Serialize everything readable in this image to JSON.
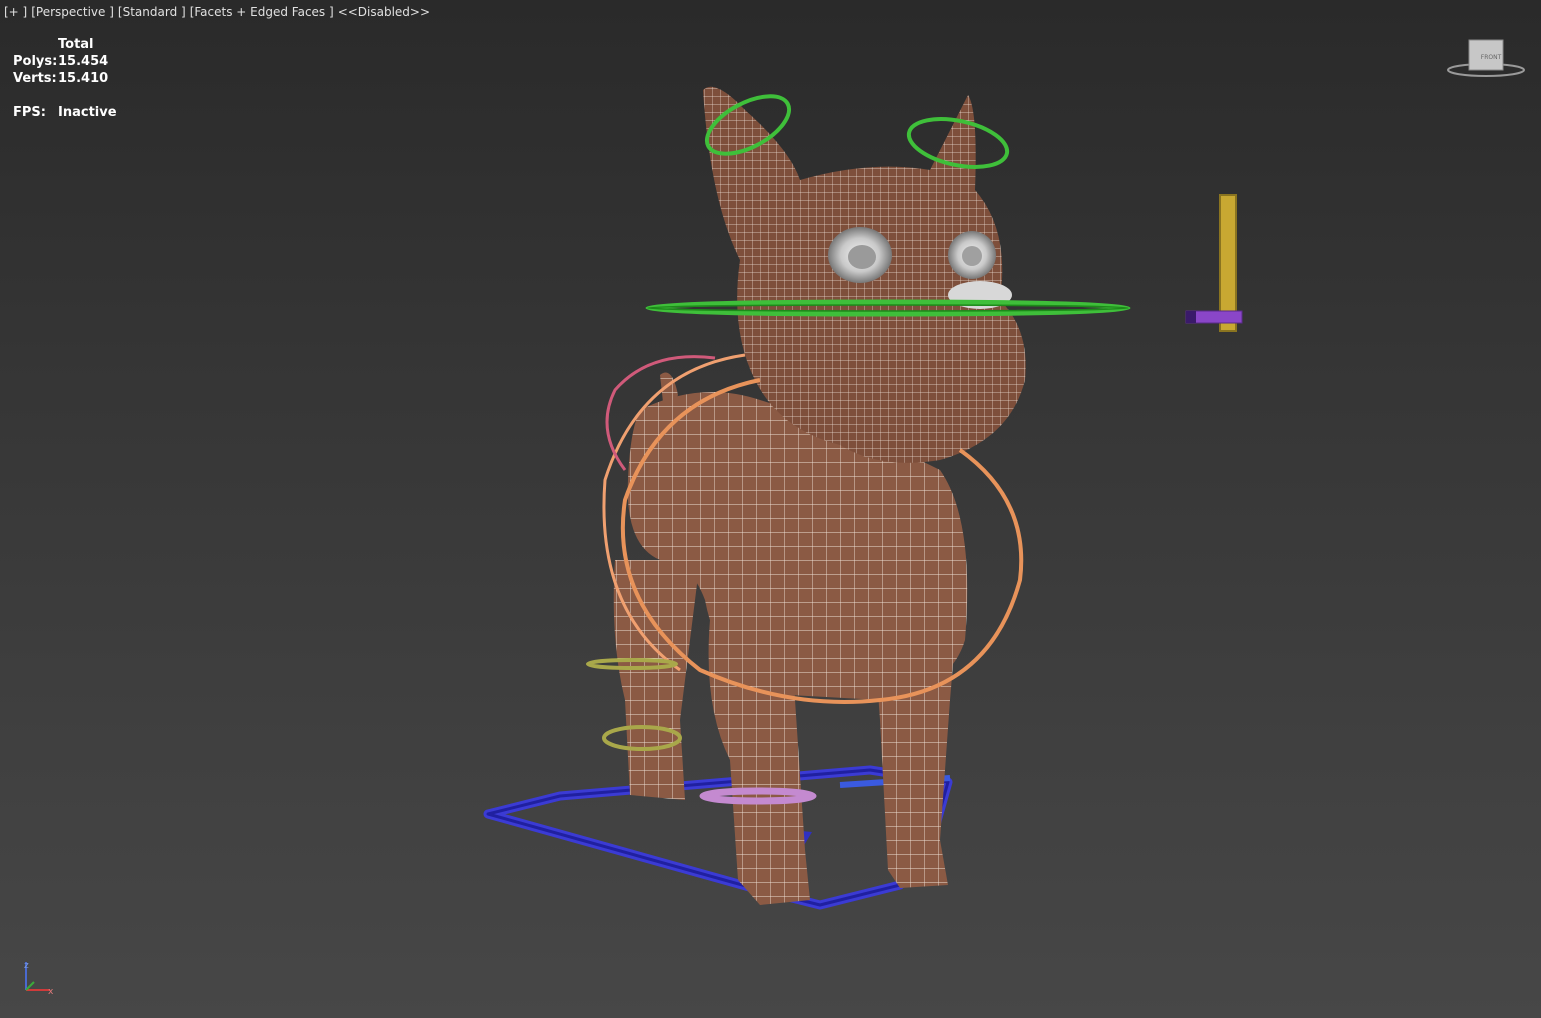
{
  "viewport": {
    "menu": "[+ ]",
    "view": "[Perspective ]",
    "shading_mode": "[Standard ]",
    "display": "[Facets + Edged Faces ]",
    "status": "<<Disabled>>"
  },
  "stats": {
    "header": "Total",
    "polys_label": "Polys:",
    "polys_value": "15.454",
    "verts_label": "Verts:",
    "verts_value": "15.410",
    "fps_label": "FPS:",
    "fps_value": "Inactive"
  },
  "viewcube": {
    "face_label": "FRONT"
  },
  "axis": {
    "z": "z",
    "x": "x"
  },
  "colors": {
    "model": "#8b5a44",
    "wire": "#f2e6dc",
    "control_green": "#3fbf3a",
    "control_orange": "#e8935a",
    "control_pink": "#d05a7a",
    "control_olive": "#a9a84a",
    "control_blue": "#3a3ad0",
    "control_purple": "#8a46c8",
    "control_yellow": "#c8a832"
  }
}
